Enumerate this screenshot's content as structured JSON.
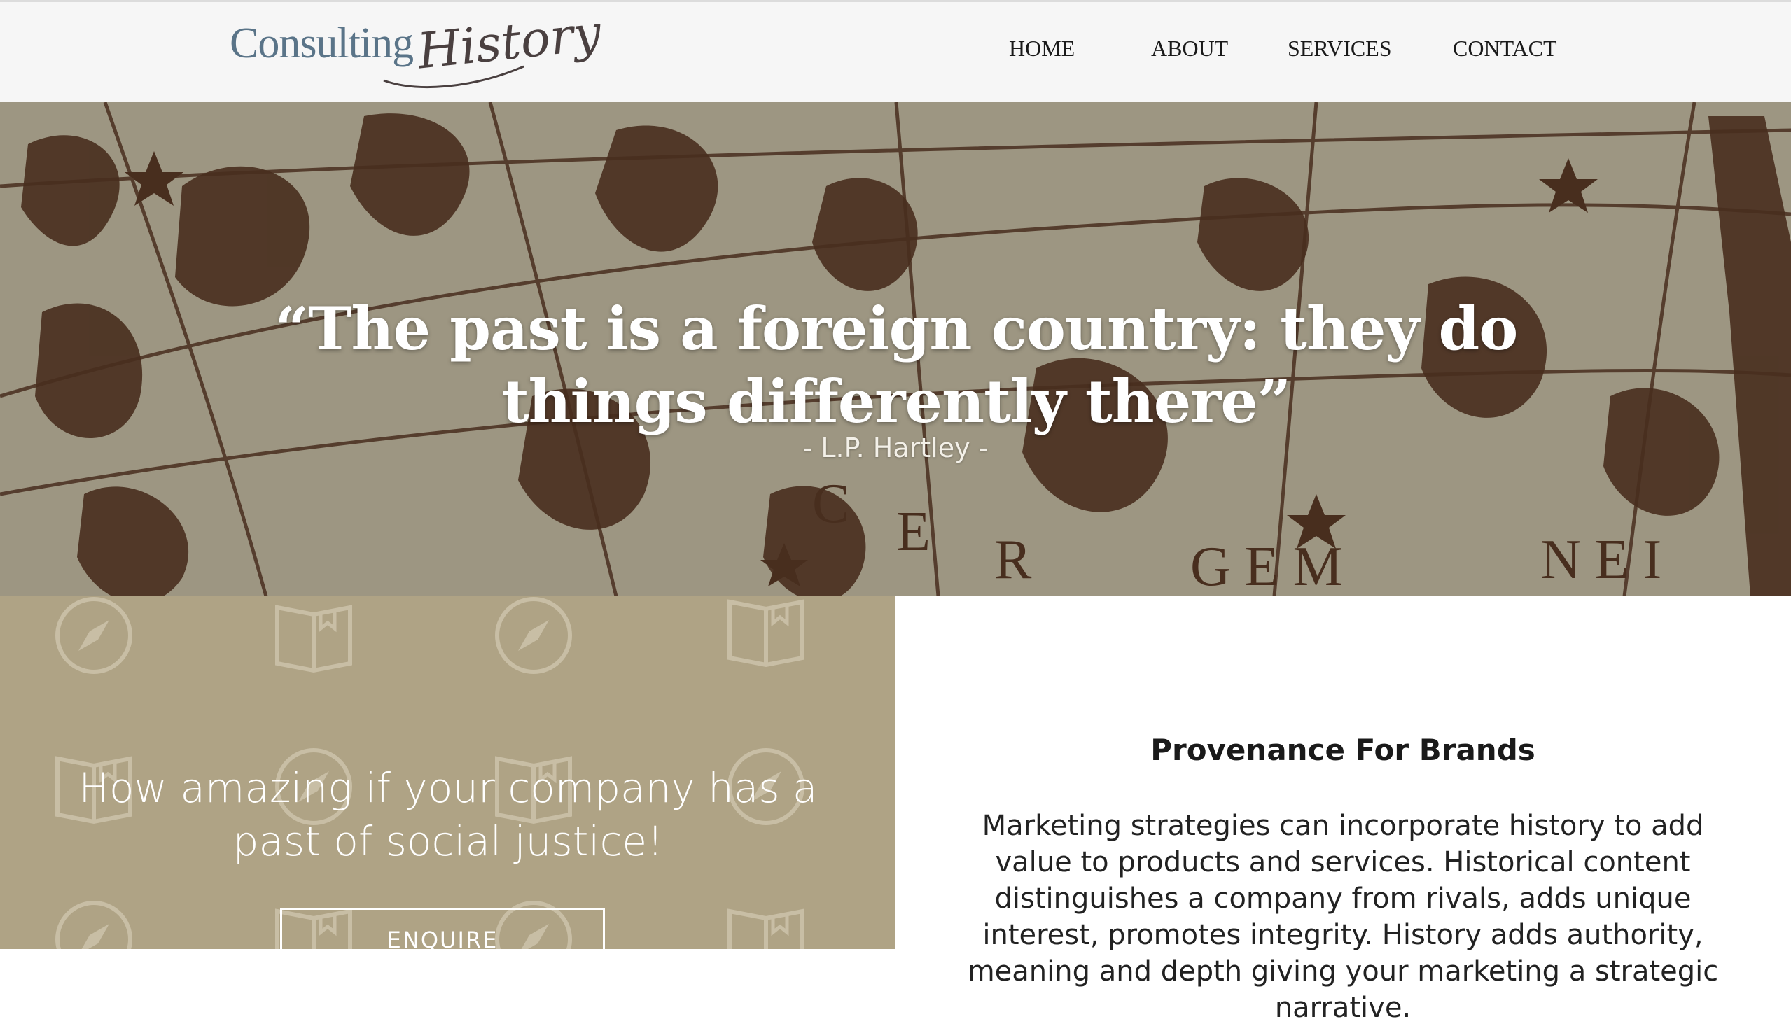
{
  "header": {
    "logo": {
      "main": "Consulting",
      "script": "History"
    },
    "nav": [
      {
        "label": "HOME"
      },
      {
        "label": "ABOUT"
      },
      {
        "label": "SERVICES"
      },
      {
        "label": "CONTACT"
      }
    ]
  },
  "hero": {
    "quote": "“The past is a foreign country: they do things differently there”",
    "attribution": "- L.P. Hartley -"
  },
  "promo": {
    "tagline": "How amazing if your company has a past of social justice!",
    "button_label": "ENQUIRE"
  },
  "section": {
    "title": "Provenance For Brands",
    "body": "Marketing strategies can incorporate history to add value to products and services. Historical content distinguishes a company from rivals, adds unique interest, promotes integrity. History adds authority, meaning and depth giving your marketing a strategic narrative."
  },
  "colors": {
    "header_bg": "#f6f6f6",
    "logo_blue": "#5a7488",
    "map_bg": "#a9a28d",
    "map_ink": "#4a2e1e",
    "panel_tan": "#afa385"
  },
  "icons": [
    "compass-icon",
    "open-book-icon"
  ]
}
